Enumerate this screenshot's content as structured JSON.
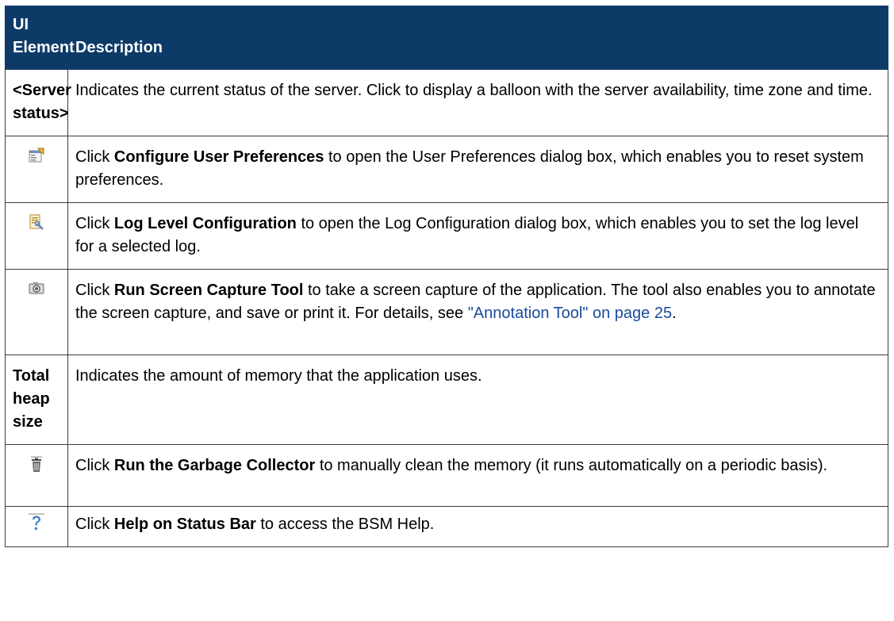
{
  "header": {
    "col_element": "UI Element",
    "col_description": "Description"
  },
  "rows": [
    {
      "element": "<Server status>",
      "description": "Indicates the current status of the server. Click to display a balloon with the server availability, time zone and time."
    },
    {
      "icon": "user-preferences-icon",
      "pre": "Click ",
      "bold": "Configure User Preferences",
      "post": " to open the User Preferences dialog box, which enables you to reset system preferences."
    },
    {
      "icon": "log-level-config-icon",
      "pre": "Click ",
      "bold": "Log Level Configuration",
      "post": " to open the Log Configuration dialog box, which enables you to set the log level for a selected log."
    },
    {
      "icon": "camera-icon",
      "pre": "Click ",
      "bold": "Run Screen Capture Tool",
      "post": " to take a screen capture of the application. The tool also enables you to annotate the screen capture, and save or print it. For details, see ",
      "link": "\"Annotation Tool\" on page 25",
      "post2": "."
    },
    {
      "element": "Total heap size",
      "description": "Indicates the amount of memory that the application uses."
    },
    {
      "icon": "trash-icon",
      "pre": "Click ",
      "bold": "Run the Garbage Collector",
      "post": " to manually clean the memory (it runs automatically on a periodic basis)."
    },
    {
      "icon": "help-icon",
      "pre": "Click ",
      "bold": "Help on Status Bar",
      "post": " to access the BSM Help."
    }
  ]
}
